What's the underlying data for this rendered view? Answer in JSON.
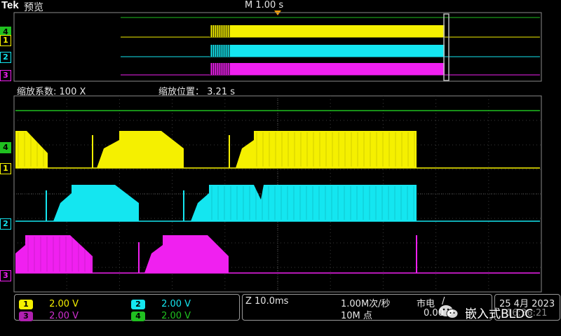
{
  "header": {
    "brand": "Tek",
    "mode": "预览",
    "timebase_marker": "M 1.00 s"
  },
  "zoom_info": {
    "factor_label": "缩放系数:",
    "factor_value": "100 X",
    "position_label": "缩放位置：",
    "position_value": "3.21 s"
  },
  "channels": [
    {
      "id": "1",
      "scale": "2.00 V",
      "color": "#f5f000"
    },
    {
      "id": "2",
      "scale": "2.00 V",
      "color": "#14e6f0"
    },
    {
      "id": "3",
      "scale": "2.00 V",
      "color": "#f020f0"
    },
    {
      "id": "4",
      "scale": "2.00 V",
      "color": "#20c020"
    }
  ],
  "status": {
    "zoom_timebase": "Z 10.0ms",
    "sample_rate": "1.00M次/秒",
    "record_length": "10M 点",
    "trigger_source": "市电",
    "trigger_slope": "/",
    "trigger_level": "0.00",
    "date": "25 4月 2023",
    "time": "16:36:21"
  },
  "watermark": {
    "text": "嵌入式BLDC",
    "icon": "wechat-icon"
  },
  "colors": {
    "grid": "#3a3a3a",
    "border": "#8a8a8a",
    "ch1": "#f5f000",
    "ch2": "#14e6f0",
    "ch3": "#f020f0",
    "ch4": "#20c020"
  }
}
